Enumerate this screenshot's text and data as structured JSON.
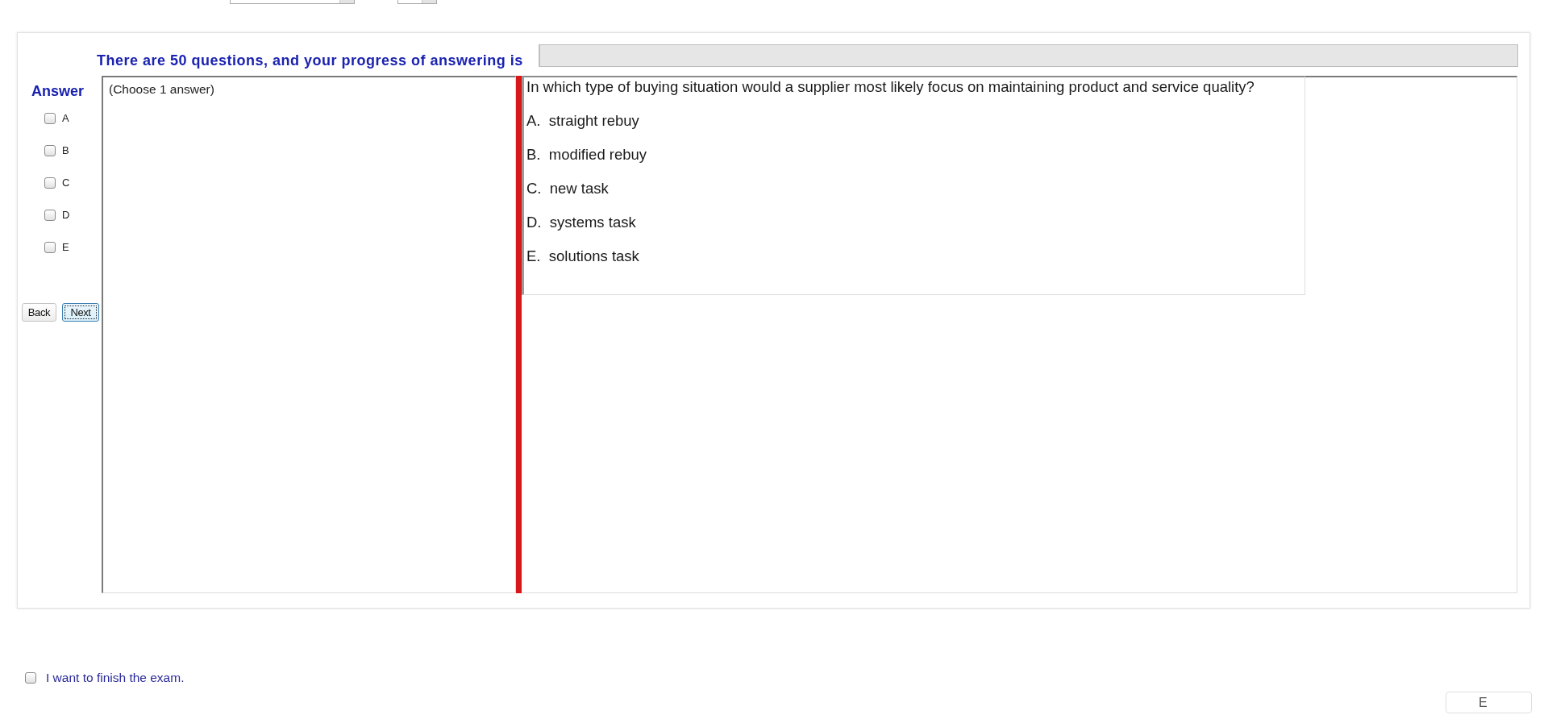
{
  "header": {
    "text": "There are 50 questions, and your progress of answering is",
    "progress": {
      "level": 0
    }
  },
  "answer_panel": {
    "title": "Answer",
    "options": [
      {
        "label": "A",
        "checked": false
      },
      {
        "label": "B",
        "checked": false
      },
      {
        "label": "C",
        "checked": false
      },
      {
        "label": "D",
        "checked": false
      },
      {
        "label": "E",
        "checked": false
      }
    ],
    "buttons": [
      {
        "label": "Back",
        "focused": false
      },
      {
        "label": "Next",
        "focused": true
      }
    ]
  },
  "answer_box": {
    "hint": "(Choose 1 answer)"
  },
  "question": {
    "text": "In which type of buying situation would a supplier most likely focus on maintaining product and service quality?",
    "options": [
      "A.  straight rebuy",
      "B.  modified rebuy",
      "C.  new task",
      "D.  systems task",
      "E.  solutions task"
    ]
  },
  "finish": {
    "label": "I want to finish the exam.",
    "checked": false
  },
  "exit_button": {
    "label": "E"
  }
}
